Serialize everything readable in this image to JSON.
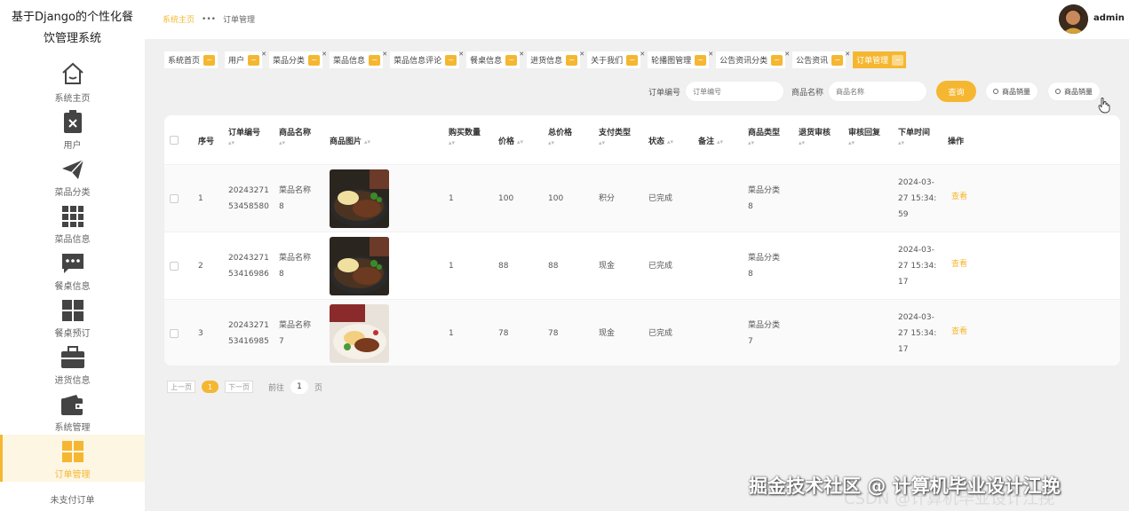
{
  "sidebar": {
    "title": "基于Django的个性化餐饮管理系统",
    "items": [
      {
        "label": "系统主页",
        "icon": "home-icon"
      },
      {
        "label": "用户",
        "icon": "clipboard-x-icon"
      },
      {
        "label": "菜品分类",
        "icon": "paper-plane-icon"
      },
      {
        "label": "菜品信息",
        "icon": "grid-icon"
      },
      {
        "label": "餐桌信息",
        "icon": "chat-bubble-icon"
      },
      {
        "label": "餐桌预订",
        "icon": "tiles-icon"
      },
      {
        "label": "进货信息",
        "icon": "briefcase-icon"
      },
      {
        "label": "系统管理",
        "icon": "wallet-icon"
      },
      {
        "label": "订单管理",
        "icon": "tiles-icon"
      }
    ],
    "partial_item": "未支付订单"
  },
  "topbar": {
    "breadcrumb_home": "系统主页",
    "breadcrumb_sep": "•••",
    "breadcrumb_current": "订单管理",
    "username": "admin"
  },
  "tabs": [
    "系统首页",
    "用户",
    "菜品分类",
    "菜品信息",
    "菜品信息评论",
    "餐桌信息",
    "进货信息",
    "关于我们",
    "轮播图管理",
    "公告资讯分类",
    "公告资讯",
    "订单管理"
  ],
  "search": {
    "order_label": "订单编号",
    "order_placeholder": "订单编号",
    "name_label": "商品名称",
    "name_placeholder": "商品名称",
    "query_button": "查询",
    "stat_button_1": "商品销量",
    "stat_button_2": "商品销量"
  },
  "table": {
    "headers": {
      "index": "序号",
      "order_no": "订单编号",
      "product_name": "商品名称",
      "product_image": "商品图片",
      "qty": "购买数量",
      "price": "价格",
      "total": "总价格",
      "pay_type": "支付类型",
      "status": "状态",
      "note": "备注",
      "product_type": "商品类型",
      "return_review": "退货审核",
      "review_reply": "审核回复",
      "order_time": "下单时间",
      "action": "操作"
    },
    "rows": [
      {
        "index": "1",
        "order_no_1": "20243271",
        "order_no_2": "53458580",
        "name_1": "菜品名称",
        "name_2": "8",
        "qty": "1",
        "price": "100",
        "total": "100",
        "pay_type": "积分",
        "status": "已完成",
        "type_1": "菜品分类",
        "type_2": "8",
        "time_1": "2024-03-",
        "time_2": "27 15:34:",
        "time_3": "59",
        "action": "查看"
      },
      {
        "index": "2",
        "order_no_1": "20243271",
        "order_no_2": "53416986",
        "name_1": "菜品名称",
        "name_2": "8",
        "qty": "1",
        "price": "88",
        "total": "88",
        "pay_type": "现金",
        "status": "已完成",
        "type_1": "菜品分类",
        "type_2": "8",
        "time_1": "2024-03-",
        "time_2": "27 15:34:",
        "time_3": "17",
        "action": "查看"
      },
      {
        "index": "3",
        "order_no_1": "20243271",
        "order_no_2": "53416985",
        "name_1": "菜品名称",
        "name_2": "7",
        "qty": "1",
        "price": "78",
        "total": "78",
        "pay_type": "现金",
        "status": "已完成",
        "type_1": "菜品分类",
        "type_2": "7",
        "time_1": "2024-03-",
        "time_2": "27 15:34:",
        "time_3": "17",
        "action": "查看"
      }
    ]
  },
  "pagination": {
    "prev": "上一页",
    "current": "1",
    "next": "下一页",
    "goto_label": "前往",
    "goto_value": "1",
    "page_unit": "页"
  },
  "watermark": {
    "main": "掘金技术社区 @ 计算机毕业设计江挽",
    "faint": "CSDN @计算机毕业设计江挽"
  },
  "colors": {
    "accent": "#f5b731",
    "background": "#f0f0f0"
  }
}
